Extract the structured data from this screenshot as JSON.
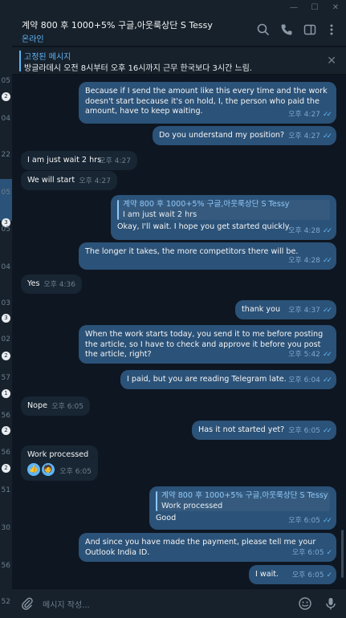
{
  "window": {
    "minimize": "—",
    "maximize": "☐",
    "close": "✕"
  },
  "sidebar": {
    "items": [
      "05",
      "2",
      "04",
      "22",
      "05",
      "3",
      "05",
      "04",
      "03",
      "3",
      "02",
      "2",
      "57",
      "1",
      "56",
      "2",
      "56",
      "2",
      "51",
      "30",
      "56",
      "52"
    ]
  },
  "header": {
    "title": "계약 800 후 1000+5% 구글,아웃룩상단 S Tessy",
    "status": "온라인"
  },
  "pinned": {
    "title": "고정된 메시지",
    "text": "방글라데시  오전 8시부터 오후 16시까지 근무 한국보다 3시간 느림.",
    "close": "✕"
  },
  "messages": [
    {
      "dir": "out",
      "text": "Because if I send the amount like this every time and the work doesn't start because it's on hold, I, the person who paid the amount, have to keep waiting.",
      "time": "오후 4:27",
      "status": "read"
    },
    {
      "dir": "out",
      "text": "Do you understand my position?",
      "time": "오후 4:27",
      "status": "read"
    },
    {
      "dir": "in",
      "text": "I am just wait 2 hrs",
      "time": "오후 4:27"
    },
    {
      "dir": "in",
      "text": "We will start",
      "time": "오후 4:27"
    },
    {
      "dir": "out",
      "reply_name": "계약 800 후 1000+5% 구글,아웃룩상단 S Tessy",
      "reply_text": "I am just wait 2 hrs",
      "text": "Okay, I'll wait. I hope you get started quickly.",
      "time": "오후 4:28",
      "status": "read"
    },
    {
      "dir": "out",
      "text": "The longer it takes, the more competitors there will be.",
      "time": "오후 4:28",
      "status": "read"
    },
    {
      "dir": "in",
      "text": "Yes",
      "time": "오후 4:36"
    },
    {
      "dir": "out",
      "text": "thank you",
      "time": "오후 4:37",
      "status": "read"
    },
    {
      "dir": "out",
      "text": "When the work starts today, you send it to me before posting the article, so I have to check and approve it before you post the article, right?",
      "time": "오후 5:42",
      "status": "read"
    },
    {
      "dir": "out",
      "text": "I paid, but you are reading Telegram late.",
      "time": "오후 6:04",
      "status": "read"
    },
    {
      "dir": "in",
      "text": "Nope",
      "time": "오후 6:05"
    },
    {
      "dir": "out",
      "text": "Has it not started yet?",
      "time": "오후 6:05",
      "status": "read"
    },
    {
      "dir": "in",
      "text": "Work processed",
      "time": "오후 6:05",
      "reactions": [
        "👍",
        "🧑"
      ]
    },
    {
      "dir": "out",
      "reply_name": "계약 800 후 1000+5% 구글,아웃룩상단 S Tessy",
      "reply_text": "Work processed",
      "text": "Good",
      "time": "오후 6:05",
      "status": "read"
    },
    {
      "dir": "out",
      "text": "And since you have made the payment, please tell me your Outlook India ID.",
      "time": "오후 6:05",
      "status": "sent"
    },
    {
      "dir": "out",
      "text": "I wait.",
      "time": "오후 6:05",
      "status": "sent"
    }
  ],
  "composer": {
    "placeholder": "메시지 작성..."
  },
  "icons": {
    "search": "search-icon",
    "call": "phone-icon",
    "panel": "sidebar-toggle-icon",
    "more": "more-vertical-icon",
    "attach": "paperclip-icon",
    "emoji": "emoji-icon",
    "mic": "microphone-icon"
  },
  "colors": {
    "background": "#0e1621",
    "outgoing": "#2b5278",
    "incoming": "#182533",
    "accent": "#5eb5f7"
  }
}
